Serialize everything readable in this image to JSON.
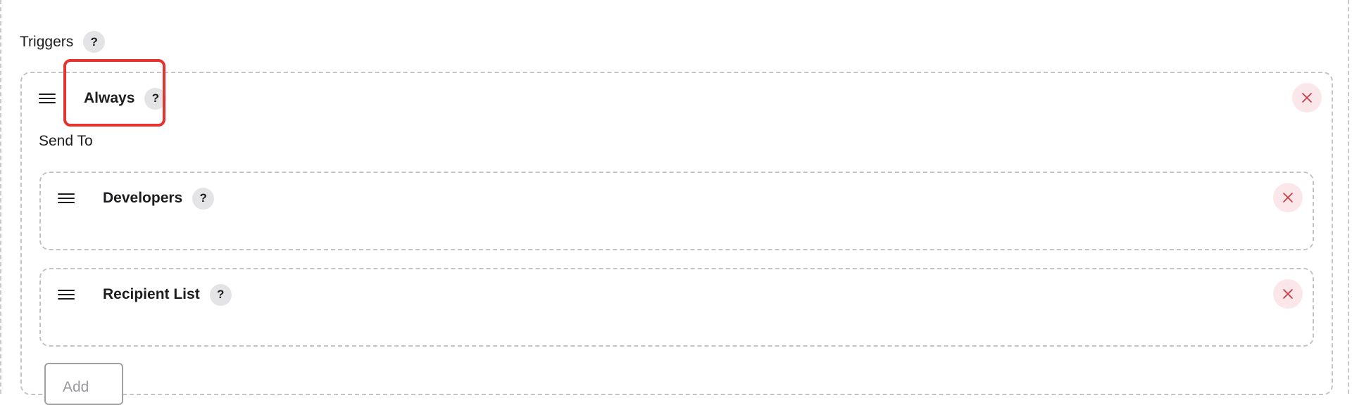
{
  "triggers": {
    "heading": "Triggers",
    "help_icon": "?"
  },
  "trigger_always": {
    "title": "Always",
    "help_icon": "?",
    "drag_icon": "hamburger-icon",
    "delete_icon": "close-icon",
    "send_to_label": "Send To",
    "recipients": [
      {
        "title": "Developers",
        "help_icon": "?"
      },
      {
        "title": "Recipient List",
        "help_icon": "?"
      }
    ],
    "add_button_label": "Add"
  },
  "colors": {
    "highlight": "#e3342f",
    "delete_bg": "#fbe7e9",
    "delete_icon": "#d0343f",
    "dashed_border": "#c4c4c8",
    "help_bg": "#e4e4e6"
  }
}
